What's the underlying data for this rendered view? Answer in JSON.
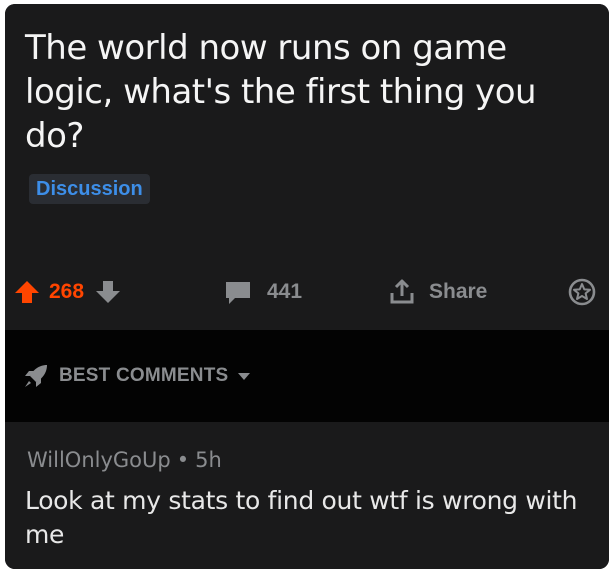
{
  "post": {
    "title": "The world now runs on game logic, what's the first thing you do?",
    "flair": "Discussion"
  },
  "actions": {
    "score": "268",
    "comments_count": "441",
    "share_label": "Share",
    "icons": [
      "upvote-icon",
      "downvote-icon",
      "comment-icon",
      "share-icon",
      "award-icon"
    ]
  },
  "sort": {
    "label": "BEST COMMENTS",
    "icons": [
      "rocket-icon",
      "caret-down-icon"
    ]
  },
  "comment": {
    "author": "WillOnlyGoUp",
    "separator": "•",
    "age": "5h",
    "body": "Look at my stats to find out wtf is wrong with me"
  },
  "colors": {
    "background": "#1a1a1b",
    "sort_bar": "#030303",
    "upvote_active": "#ff4500",
    "flair_text": "#3d8ee8",
    "muted_text": "#8a8c8f"
  }
}
